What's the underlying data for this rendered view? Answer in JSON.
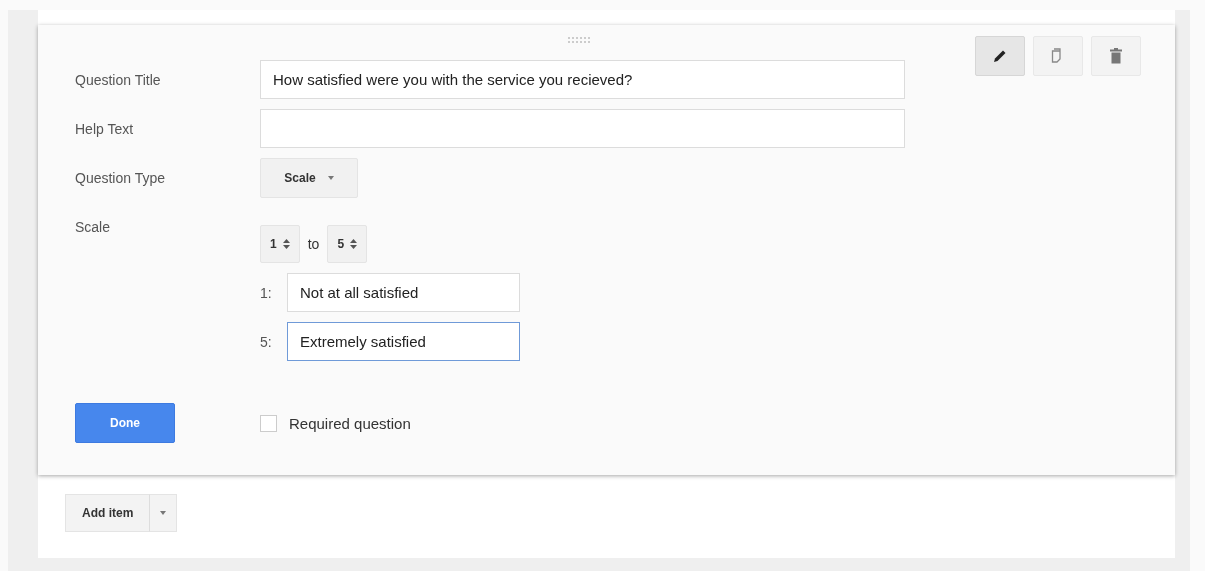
{
  "editor": {
    "fields": [
      {
        "label": "Question Title",
        "value": "How satisfied were you with the service you recieved?"
      },
      {
        "label": "Help Text"
      }
    ],
    "question_type": {
      "label": "Question Type",
      "value": "Scale"
    },
    "scale": {
      "label": "Scale",
      "from": "1",
      "to_word": "to",
      "to": "5",
      "anchors": [
        {
          "label": "1:",
          "value": "Not at all satisfied",
          "focused": false
        },
        {
          "label": "5:",
          "value": "Extremely satisfied",
          "focused": true
        }
      ]
    },
    "tools": [
      {
        "kind": "edit",
        "selected": true
      },
      {
        "kind": "duplicate",
        "selected": false
      },
      {
        "kind": "delete",
        "selected": false
      }
    ],
    "done_button": "Done",
    "required": {
      "label": "Required question",
      "checked": false
    }
  },
  "add_item": {
    "label": "Add item"
  }
}
